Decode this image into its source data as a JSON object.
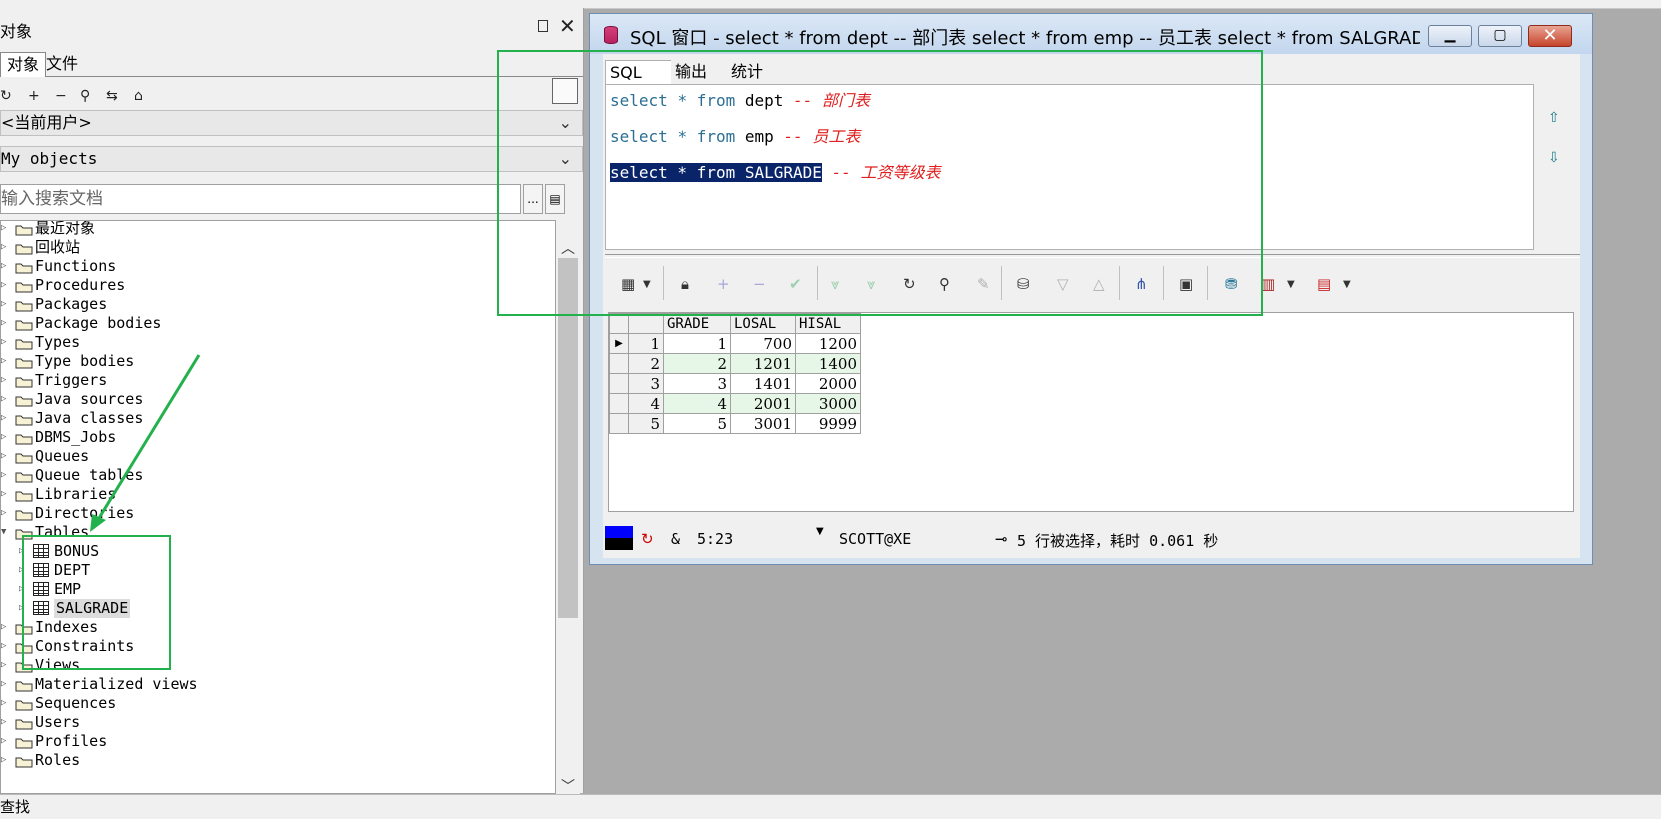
{
  "left_panel": {
    "title": "对象",
    "tabs": [
      "对象",
      "文件"
    ],
    "user_combo": "<当前用户>",
    "scope_combo": "My objects",
    "search_placeholder": "输入搜索文档",
    "search_btn": "...",
    "tree": [
      {
        "label": "最近对象"
      },
      {
        "label": "回收站"
      },
      {
        "label": "Functions"
      },
      {
        "label": "Procedures"
      },
      {
        "label": "Packages"
      },
      {
        "label": "Package bodies"
      },
      {
        "label": "Types"
      },
      {
        "label": "Type bodies"
      },
      {
        "label": "Triggers"
      },
      {
        "label": "Java sources"
      },
      {
        "label": "Java classes"
      },
      {
        "label": "DBMS_Jobs"
      },
      {
        "label": "Queues"
      },
      {
        "label": "Queue tables"
      },
      {
        "label": "Libraries"
      },
      {
        "label": "Directories"
      },
      {
        "label": "Tables"
      },
      {
        "label": "Indexes"
      },
      {
        "label": "Constraints"
      },
      {
        "label": "Views"
      },
      {
        "label": "Materialized views"
      },
      {
        "label": "Sequences"
      },
      {
        "label": "Users"
      },
      {
        "label": "Profiles"
      },
      {
        "label": "Roles"
      }
    ],
    "tables_children": [
      "BONUS",
      "DEPT",
      "EMP",
      "SALGRADE"
    ],
    "selected_table": "SALGRADE",
    "find_label": "查找"
  },
  "sql_window": {
    "title": "SQL 窗口 - select * from dept -- 部门表 select * from emp -- 员工表 select * from SALGRADE ...",
    "tabs": [
      "SQL",
      "输出",
      "统计"
    ],
    "lines": [
      {
        "kw1": "select",
        "star": "*",
        "kw2": "from",
        "obj": "dept",
        "comment": "-- 部门表"
      },
      {
        "kw1": "select",
        "star": "*",
        "kw2": "from",
        "obj": "emp",
        "comment": "-- 员工表"
      },
      {
        "selected": "select * from SALGRADE",
        "comment": "-- 工资等级表"
      }
    ],
    "result": {
      "columns": [
        "GRADE",
        "LOSAL",
        "HISAL"
      ],
      "rows": [
        {
          "n": "1",
          "grade": "1",
          "losal": "700",
          "hisal": "1200"
        },
        {
          "n": "2",
          "grade": "2",
          "losal": "1201",
          "hisal": "1400"
        },
        {
          "n": "3",
          "grade": "3",
          "losal": "1401",
          "hisal": "2000"
        },
        {
          "n": "4",
          "grade": "4",
          "losal": "2001",
          "hisal": "3000"
        },
        {
          "n": "5",
          "grade": "5",
          "losal": "3001",
          "hisal": "9999"
        }
      ]
    },
    "status": {
      "mode": "&",
      "cursor": "5:23",
      "connection": "SCOTT@XE",
      "message": "5 行被选择，耗时 0.061 秒"
    }
  },
  "colors": {
    "annotation": "#22b14c",
    "keyword": "#2b6f93",
    "comment": "#e02020",
    "selection": "#0a246a"
  }
}
